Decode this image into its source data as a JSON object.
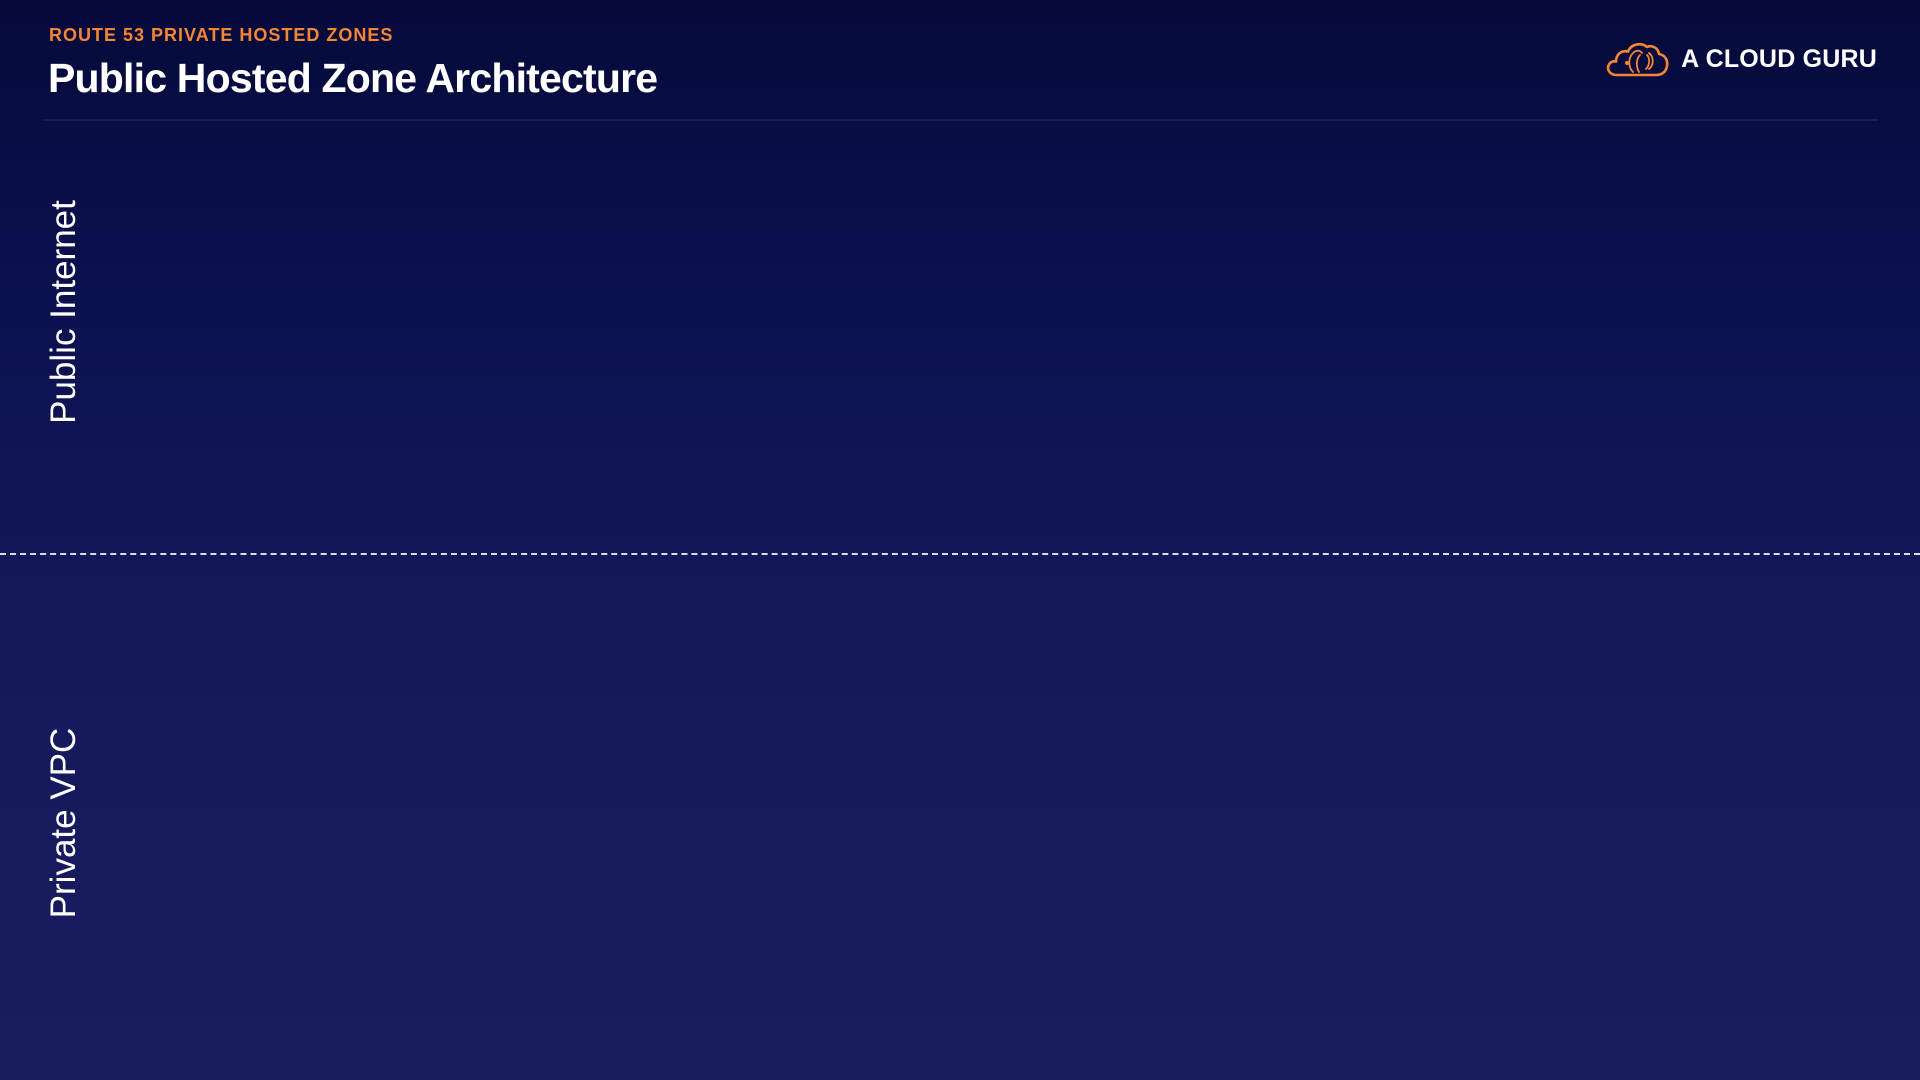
{
  "header": {
    "eyebrow": "ROUTE 53 PRIVATE HOSTED ZONES",
    "title": "Public Hosted Zone Architecture"
  },
  "brand": {
    "name": "A CLOUD GURU",
    "logo_icon": "cloud-logo-icon"
  },
  "zones": {
    "public_label": "Public Internet",
    "private_label": "Private VPC"
  },
  "colors": {
    "accent": "#f58634",
    "background_top": "#050a3a",
    "background_bottom": "#1a1c62",
    "text": "#ffffff",
    "divider": "#dcdcf0"
  }
}
